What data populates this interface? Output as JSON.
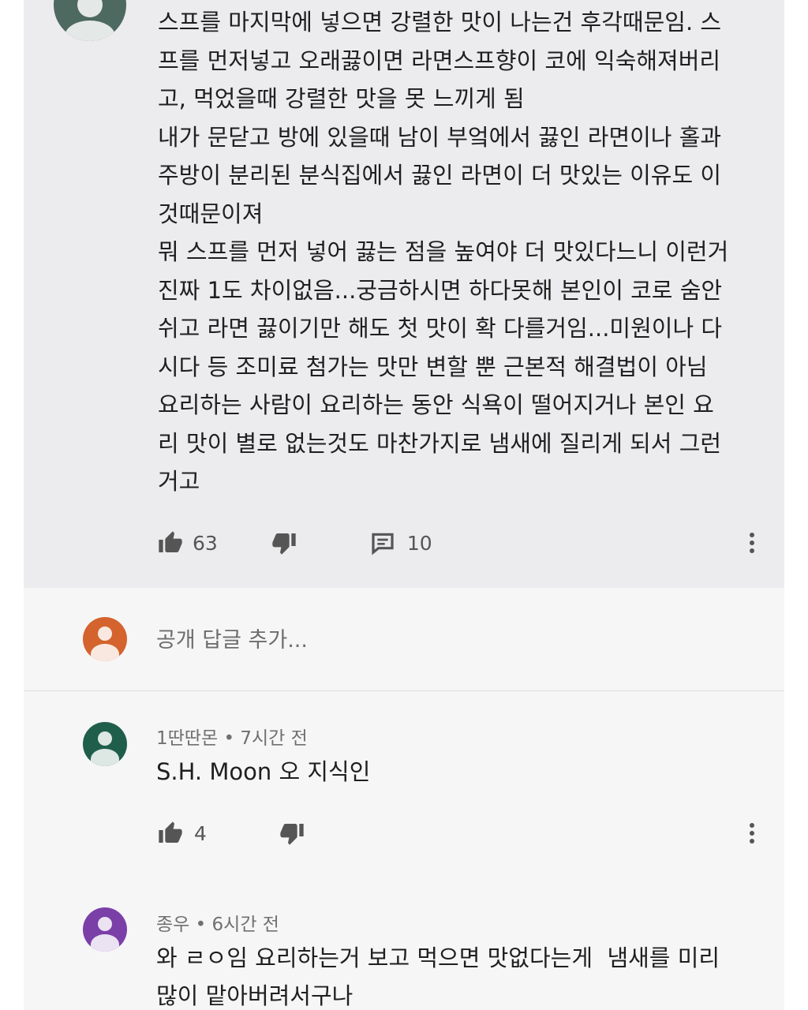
{
  "main_comment": {
    "lines": [
      "스프를 마지막에 넣으면 강렬한 맛이 나는건 후각때문임. 스",
      "프를 먼저넣고 오래끓이면 라면스프향이 코에 익숙해져버리",
      "고, 먹었을때 강렬한 맛을 못 느끼게 됨",
      "내가 문닫고 방에 있을때 남이 부엌에서 끓인 라면이나 홀과",
      "주방이 분리된 분식집에서 끓인 라면이 더 맛있는 이유도 이",
      "것때문이져",
      "뭐 스프를 먼저 넣어 끓는 점을 높여야 더 맛있다느니 이런거",
      "진짜 1도 차이없음...궁금하시면 하다못해 본인이 코로 숨안",
      "쉬고 라면 끓이기만 해도 첫 맛이 확 다를거임...미원이나 다",
      "시다 등 조미료 첨가는 맛만 변할 뿐 근본적 해결법이 아님",
      "요리하는 사람이 요리하는 동안 식욕이 떨어지거나 본인 요",
      "리 맛이 별로 없는것도 마찬가지로 냄새에 질리게 되서 그런",
      "거고"
    ],
    "like_count": "63",
    "reply_count": "10"
  },
  "reply_box": {
    "placeholder": "공개 답글 추가..."
  },
  "replies": [
    {
      "author": "1딴딴몬",
      "time": "7시간 전",
      "text": "S.H. Moon 오 지식인",
      "like_count": "4",
      "avatar_color": "#1f5e4b"
    },
    {
      "author": "종우",
      "time": "6시간 전",
      "lines": [
        "와 ㄹㅇ임 요리하는거 보고 먹으면 맛없다는게  냄새를 미리",
        "많이 맡아버려서구나"
      ],
      "avatar_color": "#7b3fa8"
    }
  ],
  "colors": {
    "main_avatar": "#4d6960",
    "my_avatar": "#d4632d",
    "icon": "#555555"
  }
}
